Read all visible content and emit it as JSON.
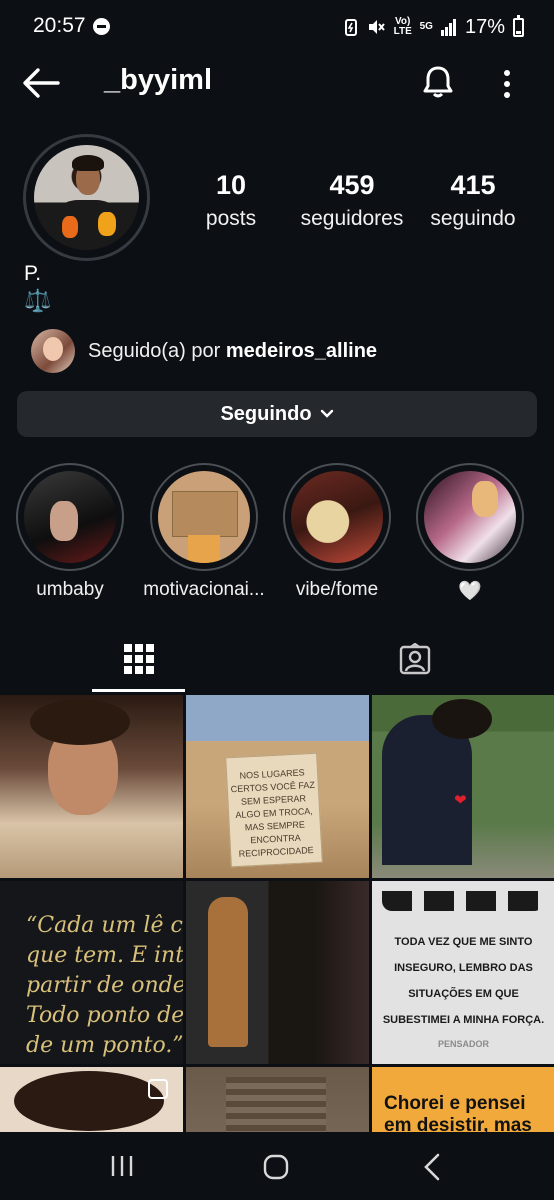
{
  "status_bar": {
    "time": "20:57",
    "network": "5G",
    "volte": "Vo) LTE",
    "battery": "17%"
  },
  "header": {
    "username": "_byyiml"
  },
  "profile": {
    "stats": [
      {
        "value": "10",
        "label": "posts"
      },
      {
        "value": "459",
        "label": "seguidores"
      },
      {
        "value": "415",
        "label": "seguindo"
      }
    ],
    "name": "P.",
    "bio": "⚖️",
    "followed_by_prefix": "Seguido(a) por ",
    "followed_by_user": "medeiros_alline"
  },
  "following_button": {
    "label": "Seguindo"
  },
  "highlights": [
    {
      "label": "umbaby"
    },
    {
      "label": "motivacionai..."
    },
    {
      "label": "vibe/fome"
    },
    {
      "label": "🤍"
    }
  ],
  "posts": {
    "sign_text": "NOS LUGARES CERTOS VOCÊ FAZ SEM ESPERAR ALGO EM TROCA, MAS SEMPRE ENCONTRA RECIPROCIDADE",
    "quote_lines": [
      "“Cada um lê com os olhos",
      "que tem. E interpreta a",
      "partir de onde os pés pisam.",
      "Todo ponto de vista é a vista",
      "de um ponto.”"
    ],
    "card_text": "TODA VEZ QUE ME SINTO INSEGURO, LEMBRO DAS SITUAÇÕES EM QUE SUBESTIMEI A MINHA FORÇA.",
    "card_source": "PENSADOR",
    "orange_text": "Chorei e pensei em desistir, mas"
  },
  "colors": {
    "background": "#0c1014",
    "button": "#25292e",
    "accent_orange": "#f2a93b"
  }
}
